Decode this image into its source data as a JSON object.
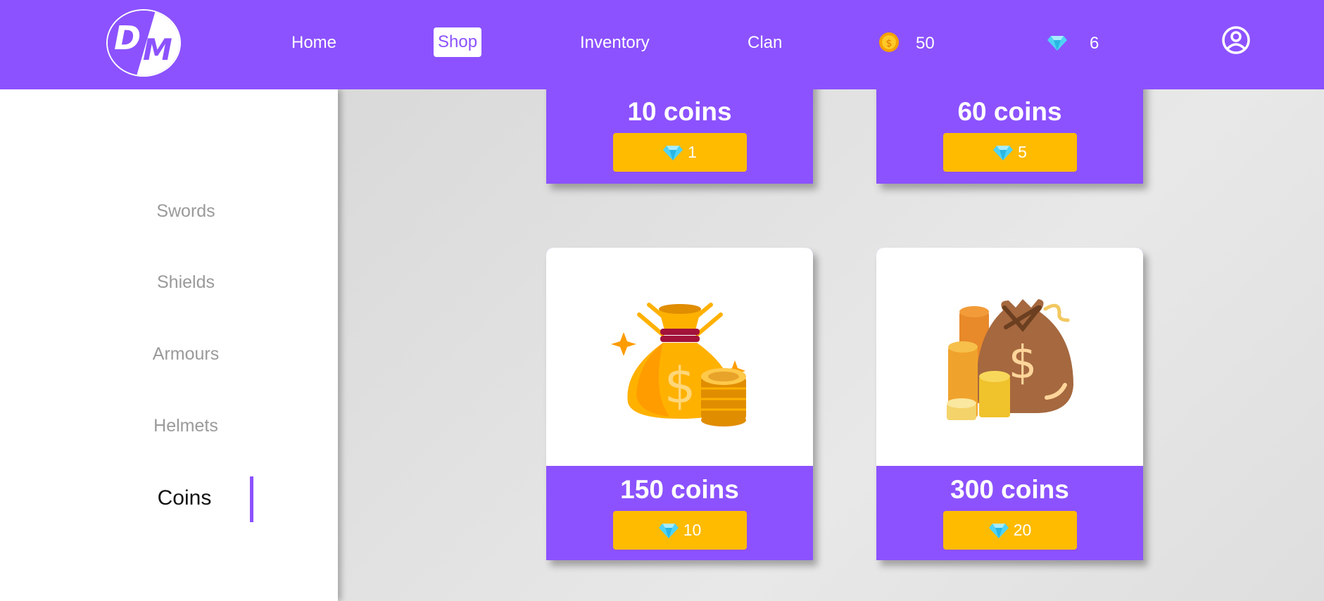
{
  "app": {
    "logo_text": "DM"
  },
  "nav": {
    "home": "Home",
    "shop": "Shop",
    "inventory": "Inventory",
    "clan": "Clan",
    "coins_value": "50",
    "gems_value": "6",
    "coin_icon": "coin-icon",
    "gem_icon": "diamond-icon",
    "profile_icon": "user-circle-icon"
  },
  "sidebar": {
    "items": [
      {
        "label": "Swords"
      },
      {
        "label": "Shields"
      },
      {
        "label": "Armours"
      },
      {
        "label": "Helmets"
      },
      {
        "label": "Coins",
        "active": true
      }
    ]
  },
  "shop": {
    "cards": [
      {
        "title": "10 coins",
        "price": "1",
        "image": ""
      },
      {
        "title": "60 coins",
        "price": "5",
        "image": ""
      },
      {
        "title": "150 coins",
        "price": "10",
        "image": "money-bag-coins"
      },
      {
        "title": "300 coins",
        "price": "20",
        "image": "money-sack-coin-stacks"
      }
    ]
  },
  "colors": {
    "primary": "#8c52ff",
    "accent": "#ffbb00",
    "background": "#e4e4e4"
  }
}
